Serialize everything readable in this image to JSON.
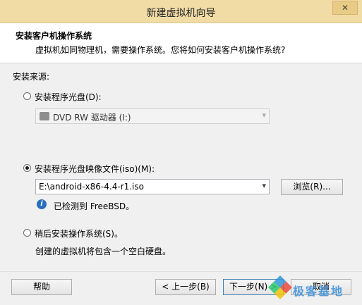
{
  "window": {
    "title": "新建虚拟机向导",
    "close_glyph": "✕"
  },
  "header": {
    "title": "安装客户机操作系统",
    "description": "虚拟机如同物理机，需要操作系统。您将如何安装客户机操作系统?"
  },
  "install_source": {
    "label": "安装来源:",
    "option_disc": {
      "label": "安装程序光盘(D):",
      "selected": false,
      "drive_value": "DVD RW 驱动器 (I:)",
      "drive_icon": "dvd-drive-icon"
    },
    "option_iso": {
      "label": "安装程序光盘映像文件(iso)(M):",
      "selected": true,
      "path_value": "E:\\android-x86-4.4-r1.iso",
      "browse_label": "浏览(R)...",
      "detected_text": "已检测到 FreeBSD。",
      "info_icon": "info-icon"
    },
    "option_later": {
      "label": "稍后安装操作系统(S)。",
      "selected": false,
      "description": "创建的虚拟机将包含一个空白硬盘。"
    }
  },
  "footer": {
    "help_label": "帮助",
    "back_label": "< 上一步(B)",
    "next_label": "下一步(N) >",
    "cancel_label": "取消"
  },
  "watermark": {
    "text": "极客基地"
  }
}
